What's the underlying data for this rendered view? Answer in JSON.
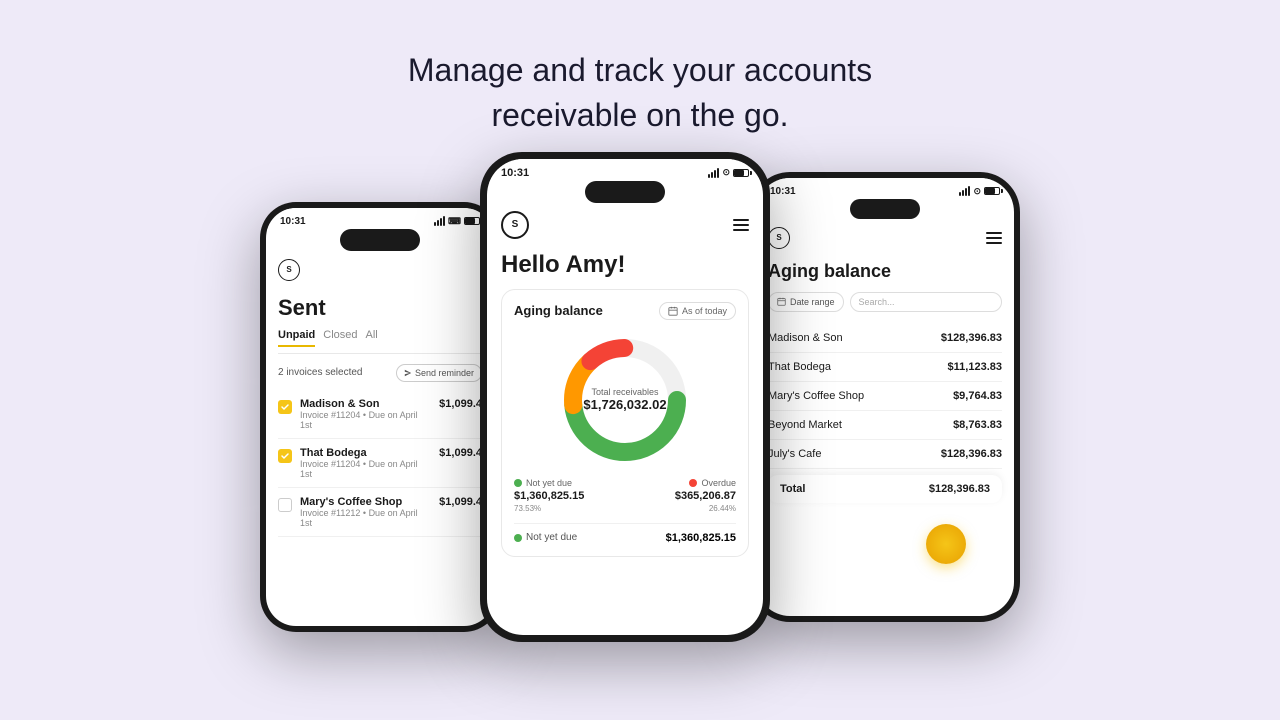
{
  "headline": {
    "line1": "Manage and track your accounts",
    "line2": "receivable on the go."
  },
  "left_phone": {
    "time": "10:31",
    "screen_title": "Sent",
    "tabs": [
      "Unpaid",
      "Closed",
      "All"
    ],
    "active_tab": "Unpaid",
    "selected_label": "2 invoices selected",
    "send_reminder_label": "Send reminder",
    "invoices": [
      {
        "name": "Madison & Son",
        "invoice": "Invoice #11204",
        "due": "Due on April 1st",
        "amount": "$1,099.4"
      },
      {
        "name": "That Bodega",
        "invoice": "Invoice #11204",
        "due": "Due on April 1st",
        "amount": "$1,099.4"
      },
      {
        "name": "Mary's Coffee Shop",
        "invoice": "Invoice #11212",
        "due": "Due on April 1st",
        "amount": "$1,099.4"
      }
    ]
  },
  "center_phone": {
    "time": "10:31",
    "greeting": "Hello Amy!",
    "aging_balance": {
      "title": "Aging balance",
      "date_label": "As of today",
      "total_label": "Total receivables",
      "total_amount": "$1,726,032.02",
      "not_yet_due": {
        "label": "Not yet due",
        "amount": "$1,360,825.15",
        "pct": "73.53%",
        "color": "#4caf50"
      },
      "overdue": {
        "label": "Overdue",
        "amount": "$365,206.87",
        "pct": "26.44%",
        "color": "#f44336"
      },
      "bottom_row_label": "Not yet due",
      "bottom_row_amount": "$1,360,825.15"
    }
  },
  "right_phone": {
    "time": "10:31",
    "title": "Aging balance",
    "date_range_label": "Date range",
    "search_placeholder": "Search...",
    "clients": [
      {
        "name": "Madison & Son",
        "amount": "$128,396.83"
      },
      {
        "name": "That Bodega",
        "amount": "$11,123.83"
      },
      {
        "name": "Mary's Coffee Shop",
        "amount": "$9,764.83"
      },
      {
        "name": "Beyond Market",
        "amount": "$8,763.83"
      },
      {
        "name": "July's Cafe",
        "amount": "$128,396.83"
      }
    ],
    "total_label": "Total",
    "total_amount": "$128,396.83"
  },
  "colors": {
    "background": "#eeeaf8",
    "not_yet_due": "#4caf50",
    "overdue": "#f44336",
    "orange_segment": "#ff9800",
    "yellow_highlight": "#f5c518"
  }
}
